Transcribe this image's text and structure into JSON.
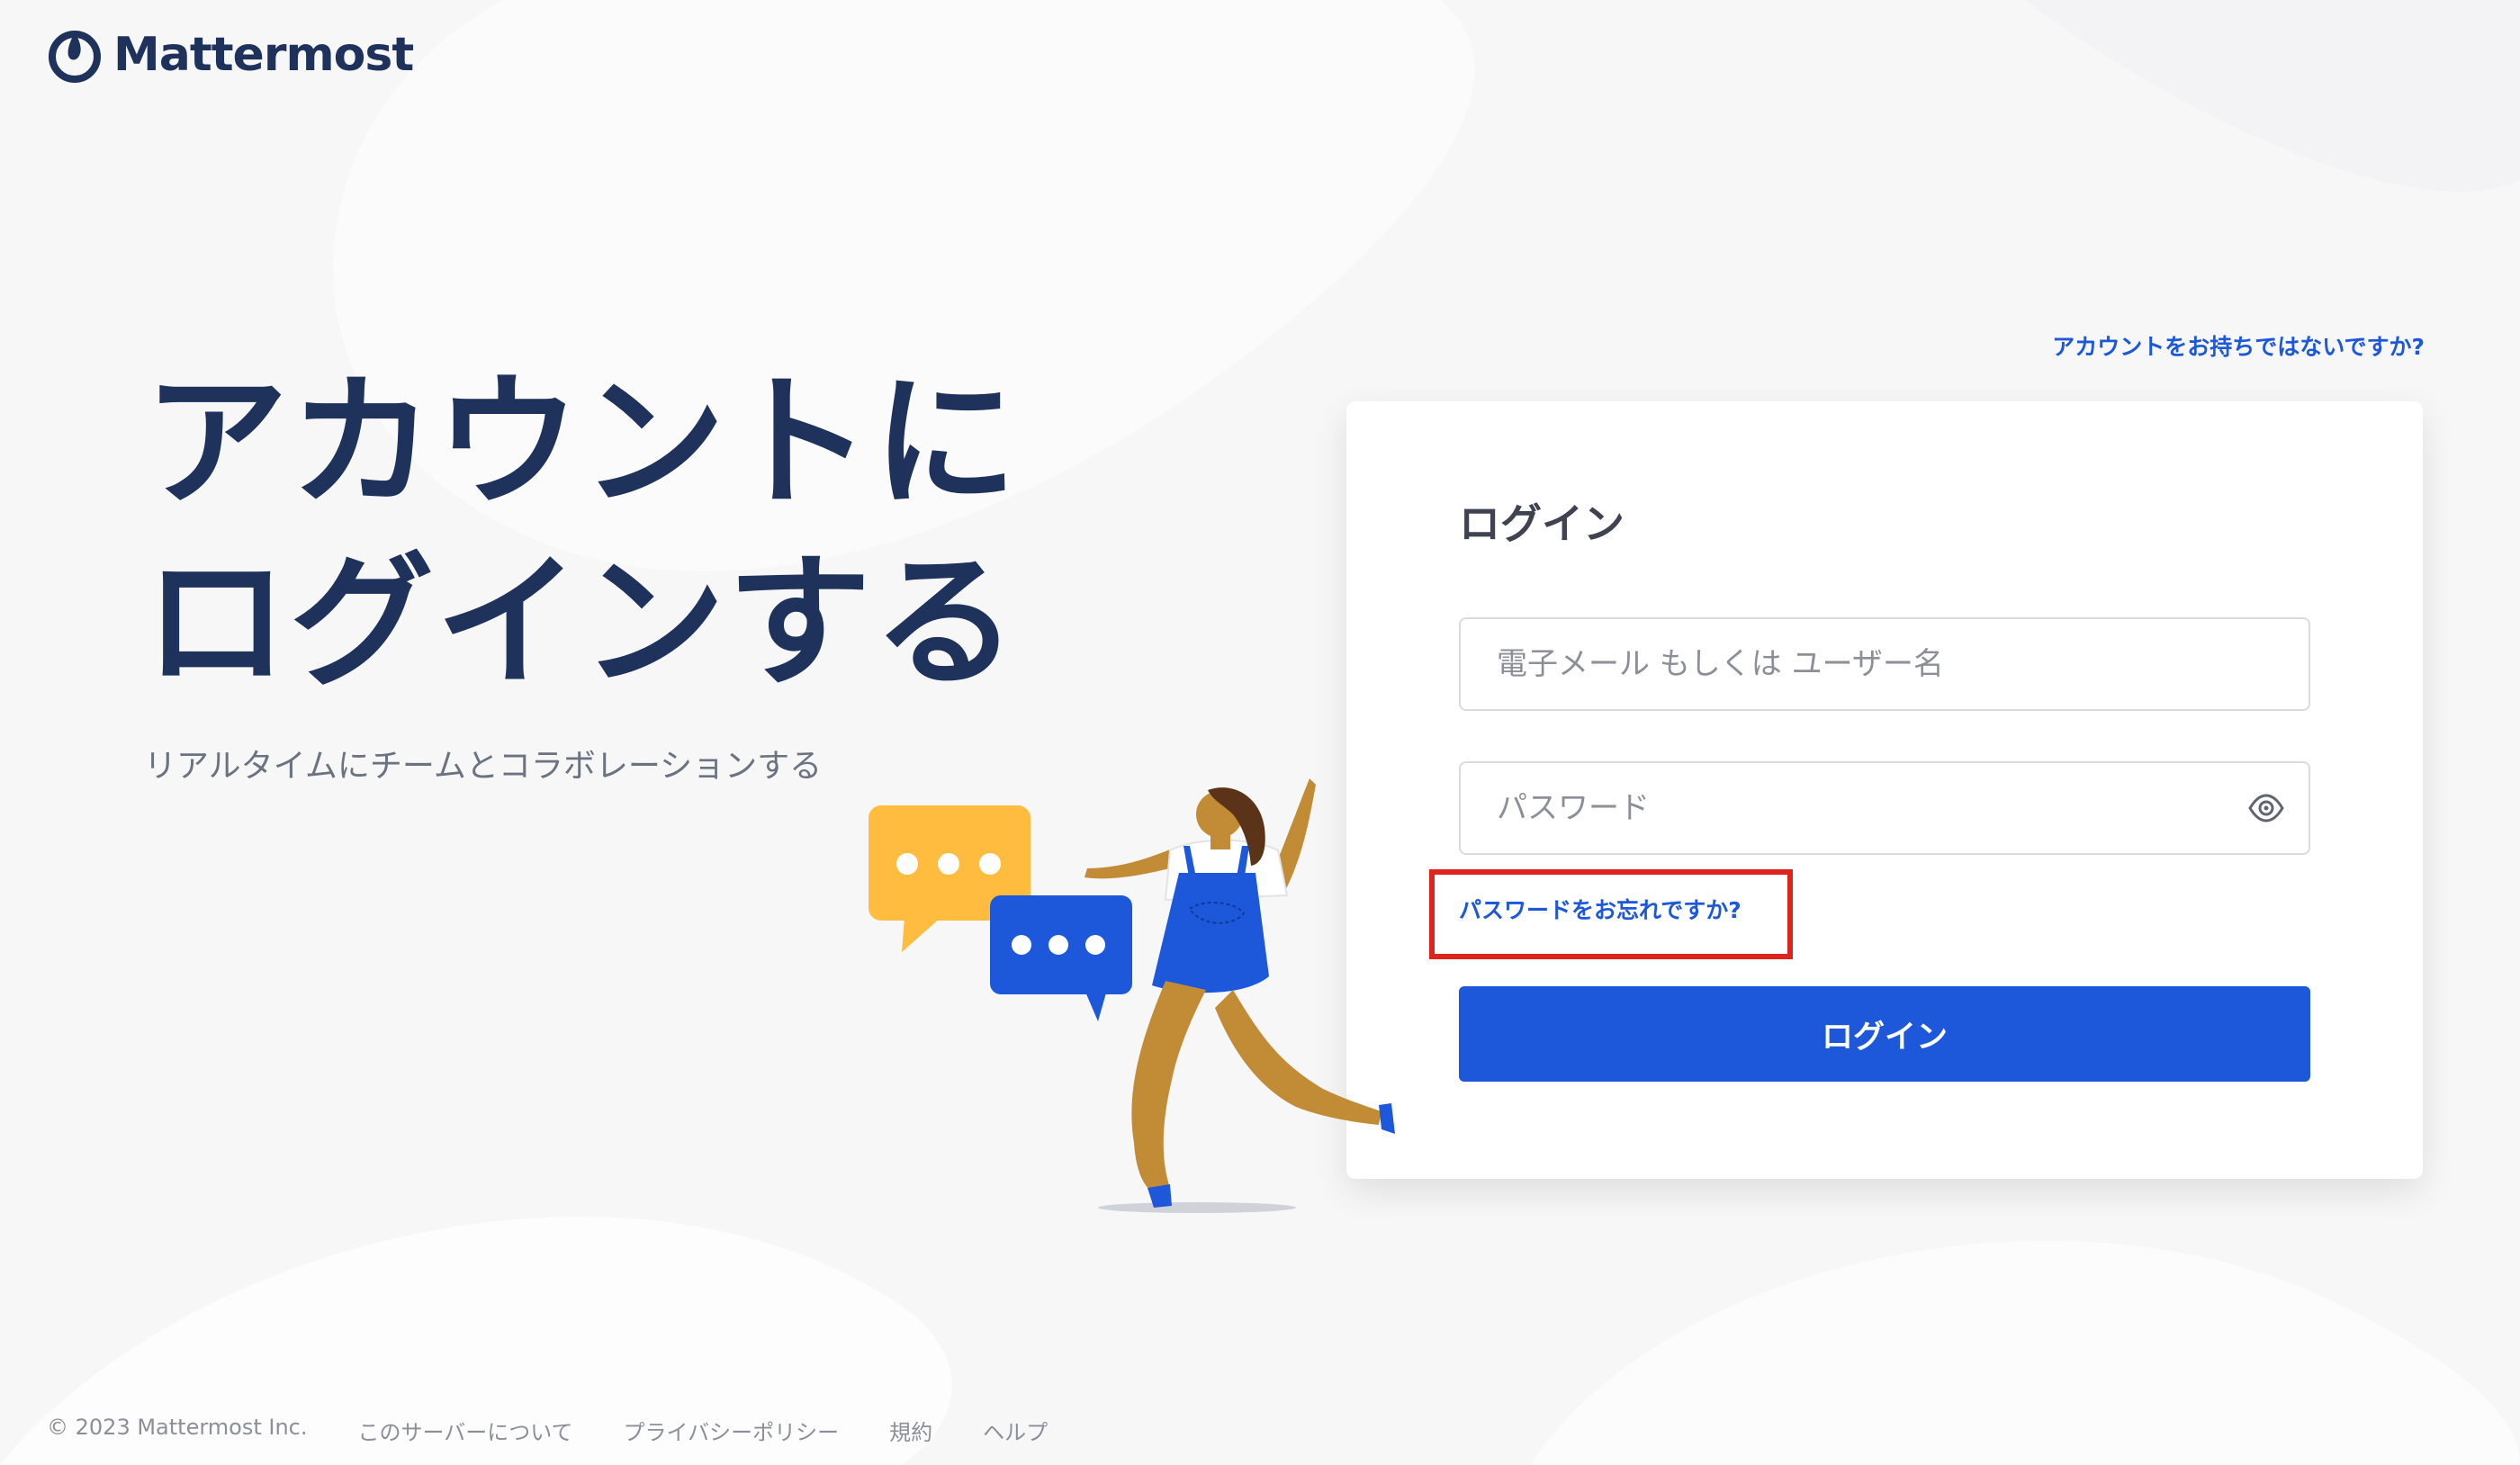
{
  "brand": {
    "name": "Mattermost",
    "primary_color": "#1c58d9",
    "heading_color": "#1e325c"
  },
  "header": {
    "signup_link": "アカウントをお持ちではないですか?"
  },
  "hero": {
    "title_line1": "アカウントに",
    "title_line2": "ログインする",
    "subtitle": "リアルタイムにチームとコラボレーションする"
  },
  "login_form": {
    "title": "ログイン",
    "email_placeholder": "電子メール もしくは ユーザー名",
    "email_value": "",
    "password_placeholder": "パスワード",
    "password_value": "",
    "show_password_icon": "eye-icon",
    "forgot_password_link": "パスワードをお忘れですか?",
    "highlight_color": "#e0231c",
    "submit_label": "ログイン"
  },
  "footer": {
    "copyright": "© 2023 Mattermost Inc.",
    "links": [
      "このサーバーについて",
      "プライバシーポリシー",
      "規約",
      "ヘルプ"
    ]
  }
}
